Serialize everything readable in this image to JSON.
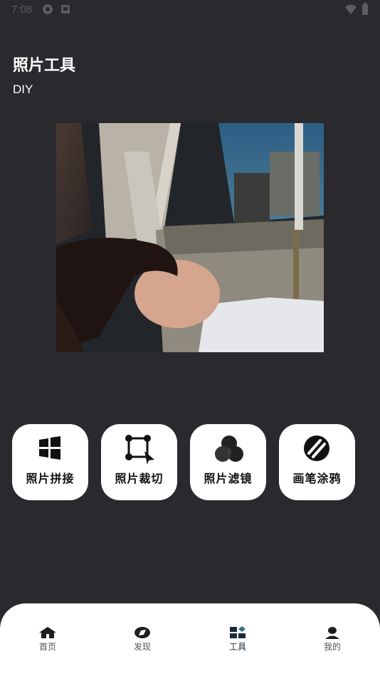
{
  "status_bar": {
    "time": "7:08"
  },
  "page": {
    "title": "照片工具",
    "subtitle": "DIY"
  },
  "photo": {
    "description_icon": "photo-of-sleeping-child-in-car"
  },
  "tools": [
    {
      "label": "照片拼接",
      "icon": "grid-windows-icon"
    },
    {
      "label": "照片裁切",
      "icon": "crop-vector-icon"
    },
    {
      "label": "照片滤镜",
      "icon": "filter-circles-icon"
    },
    {
      "label": "画笔涂鸦",
      "icon": "brush-stroke-icon"
    }
  ],
  "bottom_nav": {
    "items": [
      {
        "label": "首页",
        "icon": "home-icon",
        "active": false
      },
      {
        "label": "发现",
        "icon": "compass-icon",
        "active": false
      },
      {
        "label": "工具",
        "icon": "tools-grid-icon",
        "active": true
      },
      {
        "label": "我的",
        "icon": "user-icon",
        "active": false
      }
    ]
  },
  "colors": {
    "background": "#2a292e",
    "card": "#ffffff",
    "nav_active": "#1e2a3a"
  }
}
